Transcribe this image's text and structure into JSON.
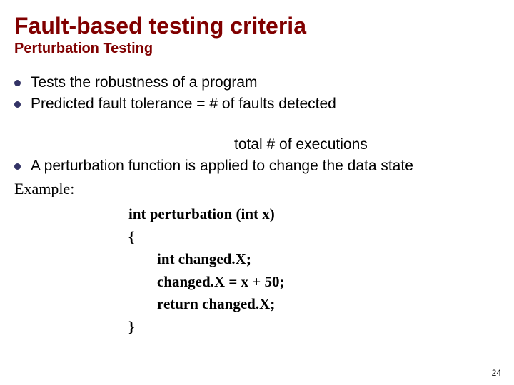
{
  "title": "Fault-based testing criteria",
  "subtitle": "Perturbation Testing",
  "bullets": {
    "b1": "Tests the robustness of a program",
    "b2_pre": "Predicted fault tolerance  = ",
    "b2_num": "# of faults detected",
    "b2_den": "total # of executions",
    "b3": "A  perturbation function is applied to change the data state"
  },
  "example_label": "Example:",
  "code": {
    "l1": "int perturbation (int x)",
    "l2": "{",
    "l3": "int changed.X;",
    "l4": "changed.X = x + 50;",
    "l5": "return changed.X;",
    "l6": "}"
  },
  "page_number": "24"
}
